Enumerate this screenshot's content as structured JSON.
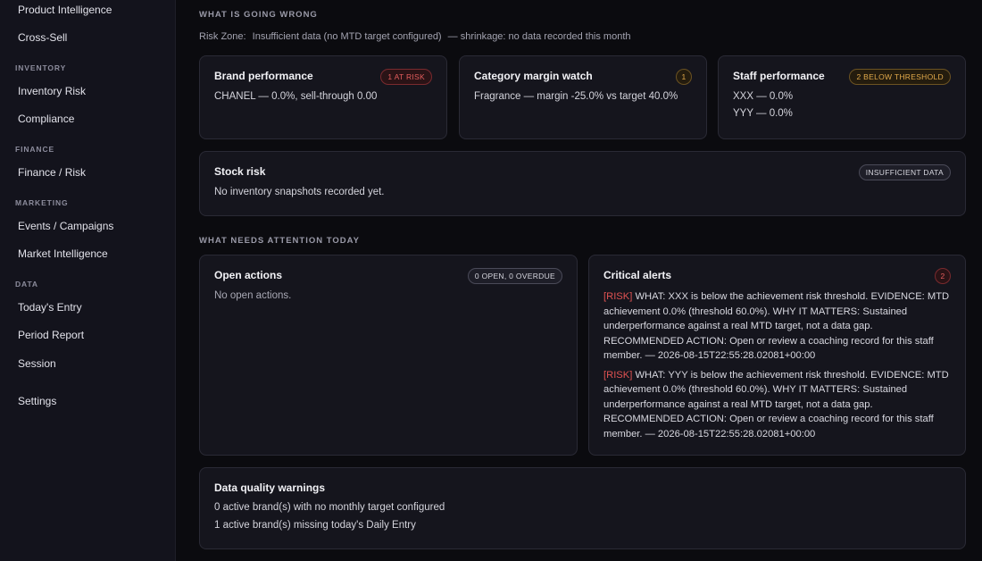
{
  "sidebar": {
    "items_top": [
      "Product Intelligence",
      "Cross-Sell"
    ],
    "inventory": {
      "heading": "INVENTORY",
      "items": [
        "Inventory Risk",
        "Compliance"
      ]
    },
    "finance": {
      "heading": "FINANCE",
      "items": [
        "Finance / Risk"
      ]
    },
    "marketing": {
      "heading": "MARKETING",
      "items": [
        "Events / Campaigns",
        "Market Intelligence"
      ]
    },
    "data": {
      "heading": "DATA",
      "items": [
        "Today's Entry",
        "Period Report",
        "Session"
      ]
    },
    "settings": "Settings"
  },
  "wrong": {
    "heading": "WHAT IS GOING WRONG",
    "risk_zone_label": "Risk Zone:",
    "risk_zone_value": "Insufficient data (no MTD target configured)",
    "shrinkage": "— shrinkage: no data recorded this month"
  },
  "brand": {
    "title": "Brand performance",
    "badge": "1 AT RISK",
    "line": "CHANEL — 0.0%, sell-through 0.00"
  },
  "category": {
    "title": "Category margin watch",
    "badge": "1",
    "line": "Fragrance — margin -25.0% vs target 40.0%"
  },
  "staff": {
    "title": "Staff performance",
    "badge": "2 BELOW THRESHOLD",
    "lines": [
      "XXX — 0.0%",
      "YYY — 0.0%"
    ]
  },
  "stock": {
    "title": "Stock risk",
    "badge": "INSUFFICIENT DATA",
    "line": "No inventory snapshots recorded yet."
  },
  "attention": {
    "heading": "WHAT NEEDS ATTENTION TODAY"
  },
  "open_actions": {
    "title": "Open actions",
    "badge": "0 OPEN, 0 OVERDUE",
    "line": "No open actions."
  },
  "critical": {
    "title": "Critical alerts",
    "badge": "2",
    "alerts": [
      {
        "tag": "[RISK]",
        "text": "WHAT: XXX is below the achievement risk threshold. EVIDENCE: MTD achievement 0.0% (threshold 60.0%). WHY IT MATTERS: Sustained underperformance against a real MTD target, not a data gap. RECOMMENDED ACTION: Open or review a coaching record for this staff member. — 2026-08-15T22:55:28.02081+00:00"
      },
      {
        "tag": "[RISK]",
        "text": "WHAT: YYY is below the achievement risk threshold. EVIDENCE: MTD achievement 0.0% (threshold 60.0%). WHY IT MATTERS: Sustained underperformance against a real MTD target, not a data gap. RECOMMENDED ACTION: Open or review a coaching record for this staff member. — 2026-08-15T22:55:28.02081+00:00"
      }
    ]
  },
  "dq": {
    "title": "Data quality warnings",
    "lines": [
      "0 active brand(s) with no monthly target configured",
      "1 active brand(s) missing today's Daily Entry"
    ]
  },
  "colors": {
    "risk_red": "#e05252",
    "amber": "#e0a84a",
    "card_bg": "#15151d",
    "sidebar_bg": "#13131c"
  }
}
